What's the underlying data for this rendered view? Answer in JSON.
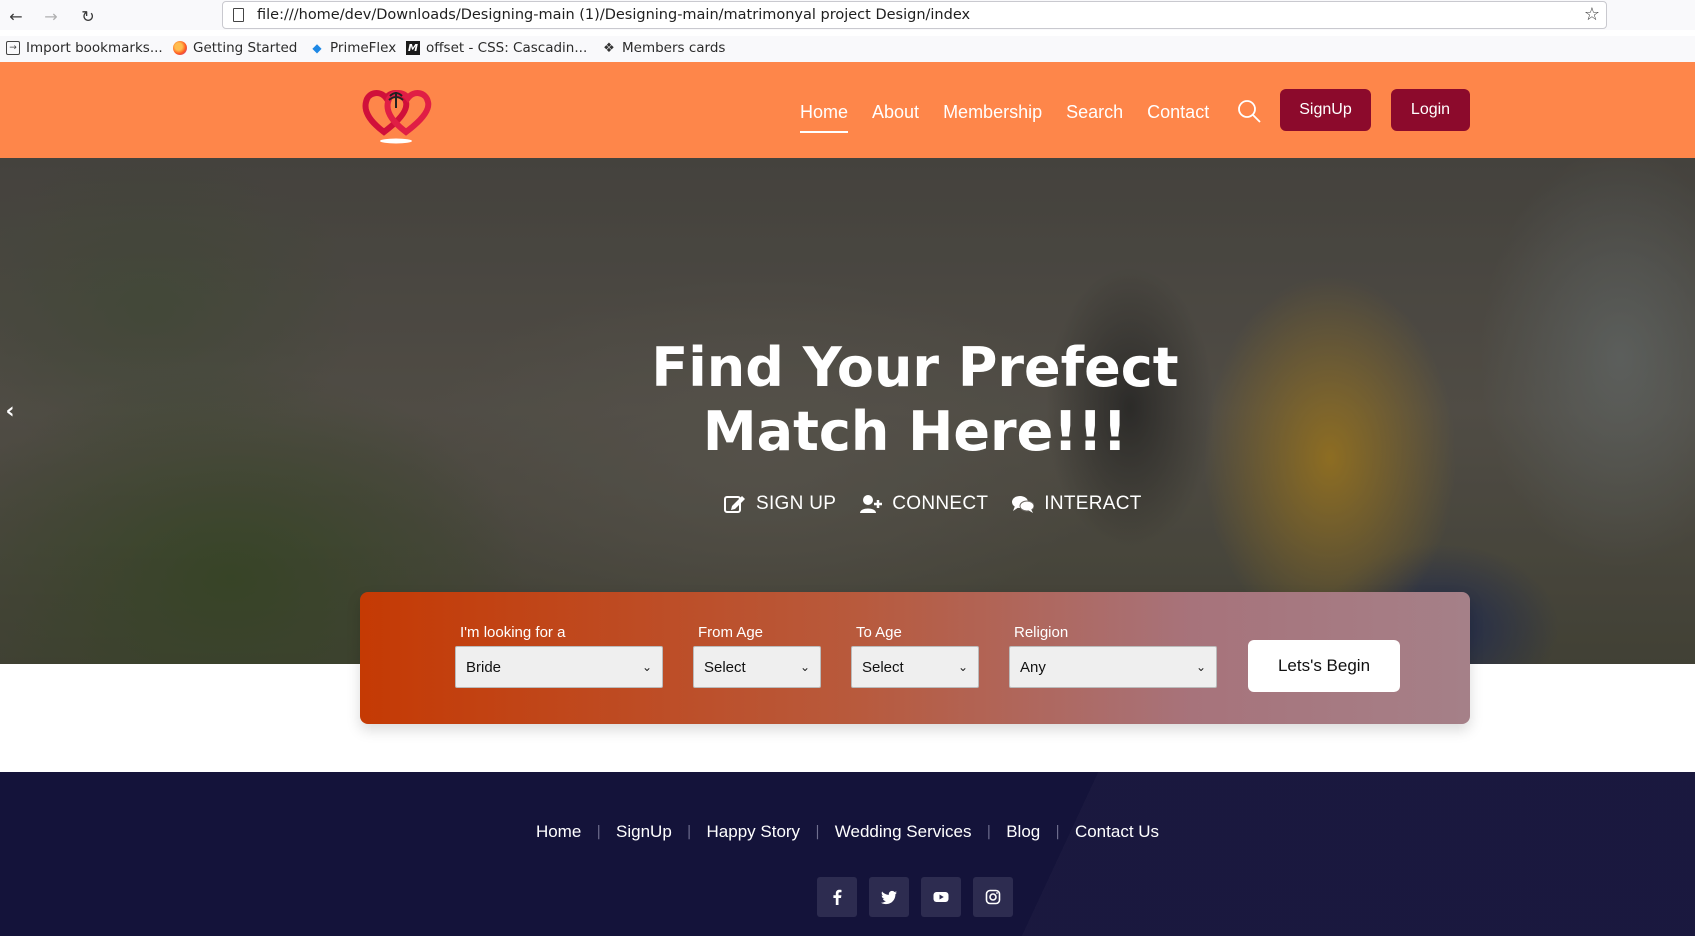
{
  "browser": {
    "url": "file:///home/dev/Downloads/Designing-main (1)/Designing-main/matrimonyal project Design/index",
    "bookmarks": [
      {
        "label": "Import bookmarks...",
        "icon": "import-icon"
      },
      {
        "label": "Getting Started",
        "icon": "firefox-icon"
      },
      {
        "label": "PrimeFlex",
        "icon": "primeflex-icon"
      },
      {
        "label": "offset - CSS: Cascadin...",
        "icon": "mdn-icon"
      },
      {
        "label": "Members cards",
        "icon": "cube-icon"
      }
    ]
  },
  "header": {
    "nav": [
      {
        "label": "Home",
        "active": true
      },
      {
        "label": "About"
      },
      {
        "label": "Membership"
      },
      {
        "label": "Search"
      },
      {
        "label": "Contact"
      }
    ],
    "signup_label": "SignUp",
    "login_label": "Login",
    "colors": {
      "bar": "#fe864a",
      "button": "#8c0a2c"
    }
  },
  "hero": {
    "title_line1": "Find Your Prefect",
    "title_line2": "Match Here!!!",
    "steps": [
      {
        "label": "SIGN UP",
        "icon": "edit-icon"
      },
      {
        "label": "CONNECT",
        "icon": "user-plus-icon"
      },
      {
        "label": "INTERACT",
        "icon": "chat-icon"
      }
    ]
  },
  "search": {
    "looking_for_label": "I'm looking for a",
    "looking_for_value": "Bride",
    "from_age_label": "From Age",
    "from_age_value": "Select",
    "to_age_label": "To Age",
    "to_age_value": "Select",
    "religion_label": "Religion",
    "religion_value": "Any",
    "submit_label": "Lets's Begin"
  },
  "footer": {
    "links": [
      "Home",
      "SignUp",
      "Happy Story",
      "Wedding Services",
      "Blog",
      "Contact Us"
    ],
    "socials": [
      "facebook-icon",
      "twitter-icon",
      "youtube-icon",
      "instagram-icon"
    ],
    "color": "#14133a"
  }
}
